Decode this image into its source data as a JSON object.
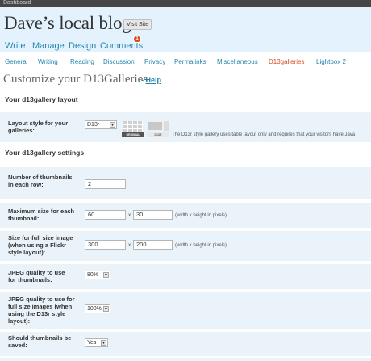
{
  "admin_bar": {
    "label": "Dashboard"
  },
  "header": {
    "blog_title": "Dave’s local blog",
    "visit_site_label": "Visit Site"
  },
  "menu": {
    "items": [
      "Write",
      "Manage",
      "Design",
      "Comments"
    ],
    "comments_badge": "1"
  },
  "submenu": {
    "items": [
      "General",
      "Writing",
      "Reading",
      "Discussion",
      "Privacy",
      "Permalinks",
      "Miscellaneous",
      "D13galleries",
      "Lightbox 2"
    ],
    "active": "D13galleries"
  },
  "page": {
    "title": "Customize your D13Galleries",
    "dash": "-",
    "help_label": "Help"
  },
  "layout_section": {
    "title": "Your d13gallery layout",
    "style_label": "Layout style for your galleries:",
    "style_value": "D13r",
    "thumb_original_caption": "ORIGINAL",
    "thumb_d13r_caption": "D13R",
    "style_note": "The D13r style gallery uses table layout only and requires that your visitors have Java"
  },
  "settings_section": {
    "title": "Your d13gallery settings",
    "thumbs_per_row_label": "Number of thumbnails in each row:",
    "thumbs_per_row_value": "2",
    "max_thumb_label": "Maximum size for each thumbnail:",
    "max_thumb_width": "60",
    "max_thumb_height": "30",
    "full_size_label": "Size for full size image (when using a Flickr style layout):",
    "full_size_width": "300",
    "full_size_height": "200",
    "dimension_separator": "x",
    "dimension_hint": "(width x height in pixels)",
    "jpeg_thumb_label": "JPEG quality to use for thumbnails:",
    "jpeg_thumb_value": "80%",
    "jpeg_full_label": "JPEG quality to use for full size images (when using the D13r style layout):",
    "jpeg_full_value": "100%",
    "save_thumbs_label": "Should thumbnails be saved:",
    "save_thumbs_value": "Yes"
  },
  "icons": {
    "dropdown": "chevron-down-icon"
  },
  "colors": {
    "link": "#2583ad",
    "active": "#d54e21",
    "header_bg": "#e4f2fd",
    "row_bg": "#eaf3fa"
  }
}
